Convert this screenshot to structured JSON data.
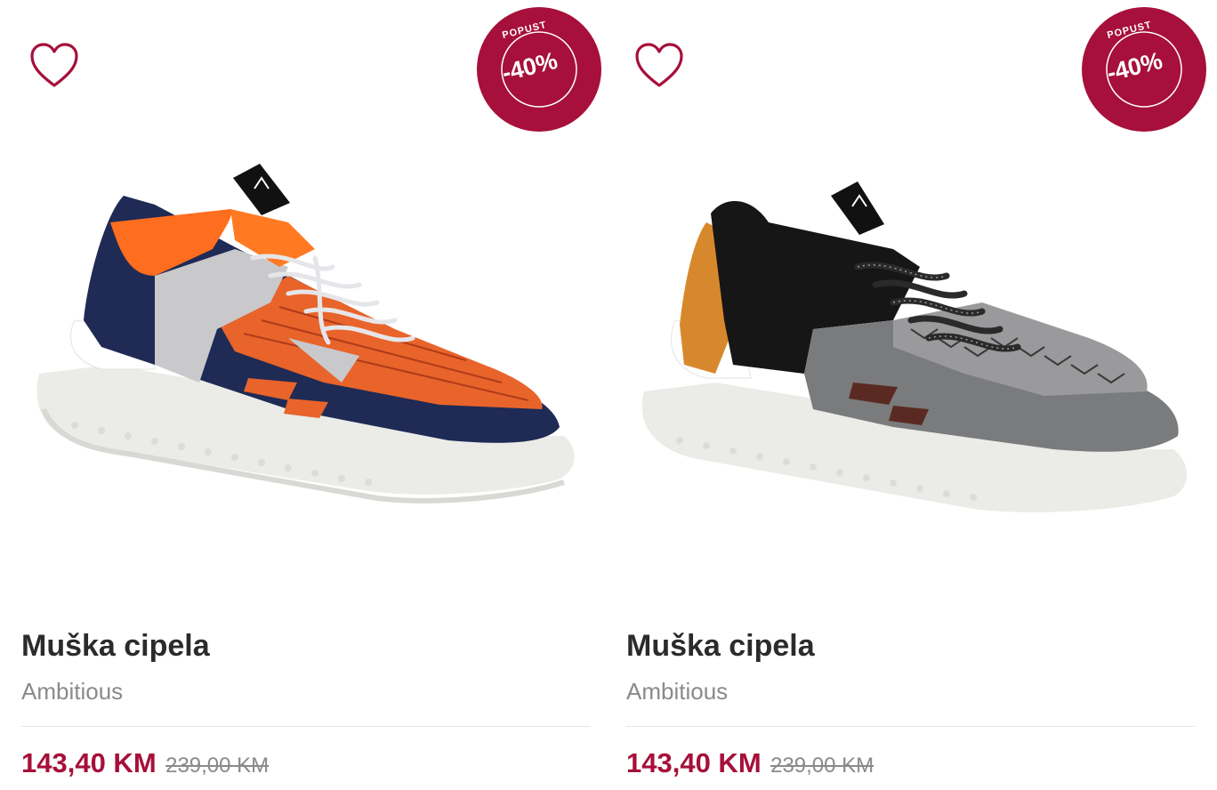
{
  "colors": {
    "accent": "#a6103a",
    "title": "#2b2b2b",
    "muted": "#8a8a8a"
  },
  "products": [
    {
      "title": "Muška cipela",
      "brand": "Ambitious",
      "price": "143,40 KM",
      "old_price": "239,00 KM",
      "badge_label": "POPUST",
      "discount": "-40%",
      "wishlist_icon": "heart-outline-icon",
      "colorway": "navy-orange"
    },
    {
      "title": "Muška cipela",
      "brand": "Ambitious",
      "price": "143,40 KM",
      "old_price": "239,00 KM",
      "badge_label": "POPUST",
      "discount": "-40%",
      "wishlist_icon": "heart-outline-icon",
      "colorway": "black-grey"
    }
  ]
}
